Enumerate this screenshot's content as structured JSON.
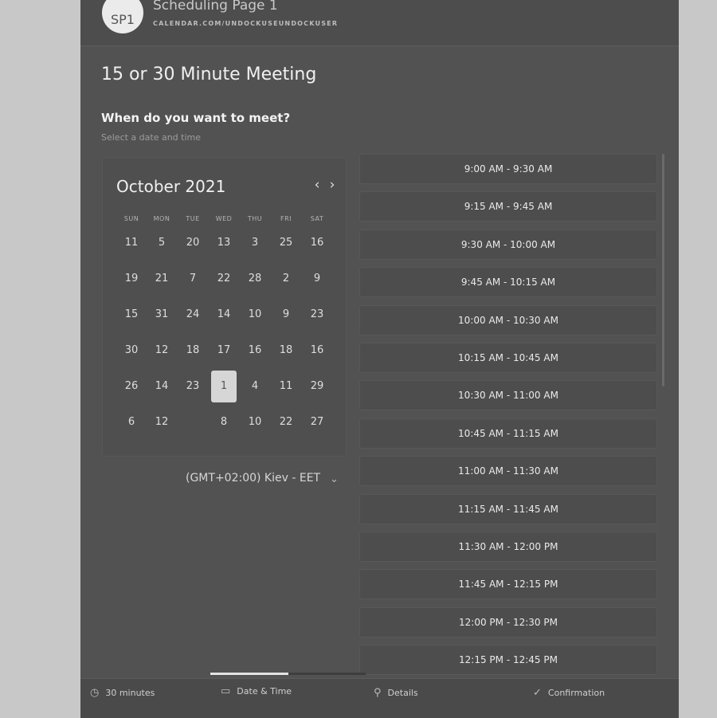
{
  "header": {
    "avatar_initials": "SP1",
    "page_name": "Scheduling Page 1",
    "page_url": "CALENDAR.COM/UNDOCKUSEUNDOCKUSER"
  },
  "event": {
    "title": "15 or 30 Minute Meeting",
    "question": "When do you want to meet?",
    "subtitle": "Select a date and time"
  },
  "calendar": {
    "month_label": "October 2021",
    "prev_icon": "chevron-left-icon",
    "next_icon": "chevron-right-icon",
    "weekdays": [
      "SUN",
      "MON",
      "TUE",
      "WED",
      "THU",
      "FRI",
      "SAT"
    ],
    "weeks": [
      [
        "11",
        "5",
        "20",
        "13",
        "3",
        "25",
        "16"
      ],
      [
        "19",
        "21",
        "7",
        "22",
        "28",
        "2",
        "9"
      ],
      [
        "15",
        "31",
        "24",
        "14",
        "10",
        "9",
        "23"
      ],
      [
        "30",
        "12",
        "18",
        "17",
        "16",
        "18",
        "16"
      ],
      [
        "26",
        "14",
        "23",
        "1",
        "4",
        "11",
        "29"
      ],
      [
        "6",
        "12",
        "",
        "8",
        "10",
        "22",
        "27"
      ]
    ],
    "selected_day": "1"
  },
  "timezone": {
    "label": "(GMT+02:00) Kiev - EET",
    "icon": "chevron-down-icon"
  },
  "time_slots": [
    "9:00 AM - 9:30 AM",
    "9:15 AM - 9:45 AM",
    "9:30 AM - 10:00 AM",
    "9:45 AM - 10:15 AM",
    "10:00 AM - 10:30 AM",
    "10:15 AM - 10:45 AM",
    "10:30 AM - 11:00 AM",
    "10:45 AM - 11:15 AM",
    "11:00 AM - 11:30 AM",
    "11:15 AM - 11:45 AM",
    "11:30 AM - 12:00 PM",
    "11:45 AM - 12:15 PM",
    "12:00 PM - 12:30 PM",
    "12:15 PM - 12:45 PM"
  ],
  "progress": {
    "fraction": 0.5
  },
  "footer": {
    "duration_label": "30 minutes",
    "duration_icon": "clock-icon",
    "datetime_label": "Date & Time",
    "datetime_icon": "calendar-icon",
    "step3_label": "Details",
    "step3_icon": "user-icon",
    "step4_label": "Confirmation",
    "step4_icon": "check-icon"
  },
  "colors": {
    "background": "#c8c8c8",
    "panel": "#525252",
    "selected": "#d6d6d6"
  }
}
